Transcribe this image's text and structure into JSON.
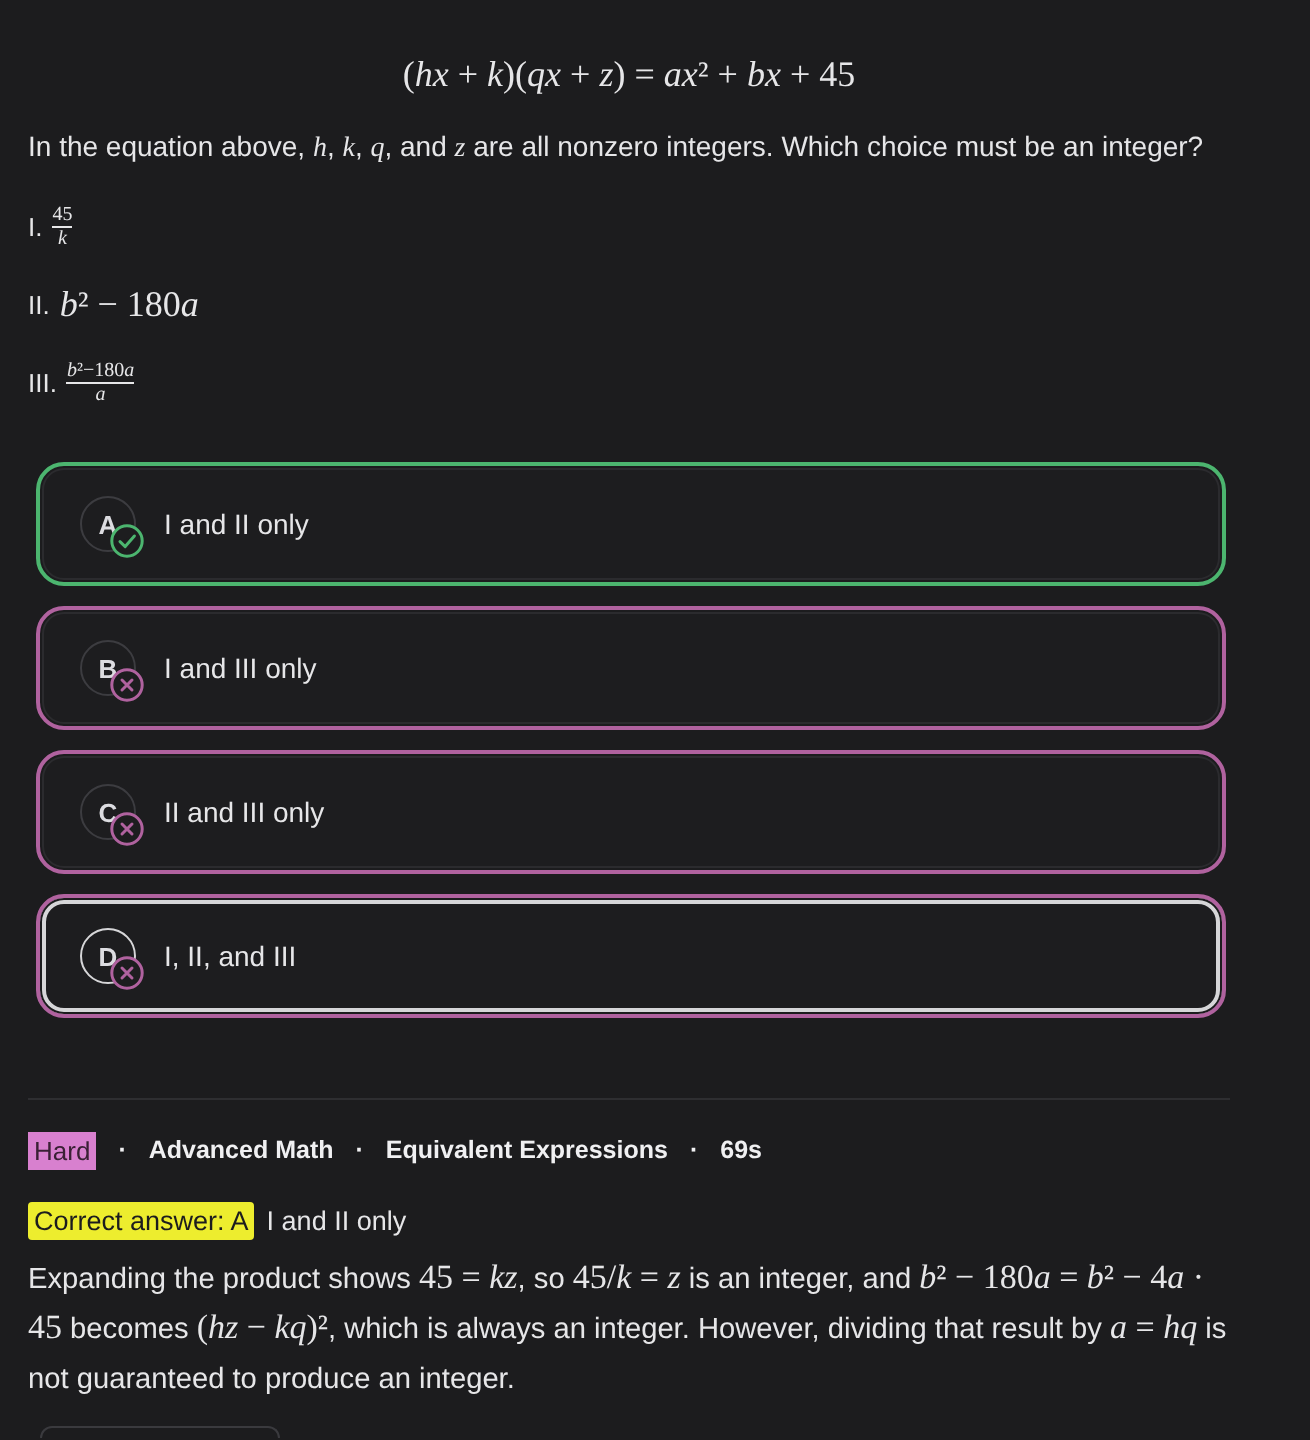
{
  "equation": "(hx + k)(qx + z) = ax² + bx + 45",
  "question": "In the equation above, *h*, *k*, *q*, and *z* are all nonzero integers. Which choice must be an integer?",
  "statements": [
    {
      "kind": "fraction",
      "label": "I.",
      "numerator": "45",
      "denominator": "k"
    },
    {
      "kind": "expression",
      "label": "II.",
      "expression": "b² − 180a"
    },
    {
      "kind": "fraction",
      "label": "III.",
      "numerator": "b²−180a",
      "denominator": "a"
    }
  ],
  "options": [
    {
      "letter": "A",
      "text": "I and II only",
      "selected": false,
      "correct": true
    },
    {
      "letter": "B",
      "text": "I and III only",
      "selected": false,
      "correct": false
    },
    {
      "letter": "C",
      "text": "II and III only",
      "selected": false,
      "correct": false
    },
    {
      "letter": "D",
      "text": "I, II, and III",
      "selected": true,
      "correct": false
    }
  ],
  "meta": [
    {
      "kind": "badge",
      "text": "Hard"
    },
    {
      "kind": "separator",
      "text": "·"
    },
    {
      "kind": "text",
      "text": "Advanced Math"
    },
    {
      "kind": "separator",
      "text": "·"
    },
    {
      "kind": "text",
      "text": "Equivalent Expressions"
    },
    {
      "kind": "separator",
      "text": "·"
    },
    {
      "kind": "text",
      "text": "69s"
    }
  ],
  "correct_answer": {
    "label": "Correct answer: A",
    "text": "I and II only"
  },
  "explanation": [
    {
      "kind": "text",
      "text": "Expanding the product shows "
    },
    {
      "kind": "math",
      "text": "45 = kz"
    },
    {
      "kind": "text",
      "text": ", so "
    },
    {
      "kind": "math",
      "text": "45/k = z"
    },
    {
      "kind": "text",
      "text": " is an integer, and "
    },
    {
      "kind": "math",
      "text": "b² − 180a = b² − 4a · 45"
    },
    {
      "kind": "text",
      "text": " becomes "
    },
    {
      "kind": "math",
      "text": "(hz − kq)²"
    },
    {
      "kind": "text",
      "text": ", which is always an integer. However, dividing that result by "
    },
    {
      "kind": "math",
      "text": "a = hq"
    },
    {
      "kind": "text",
      "text": " is not guaranteed to produce an integer."
    }
  ]
}
